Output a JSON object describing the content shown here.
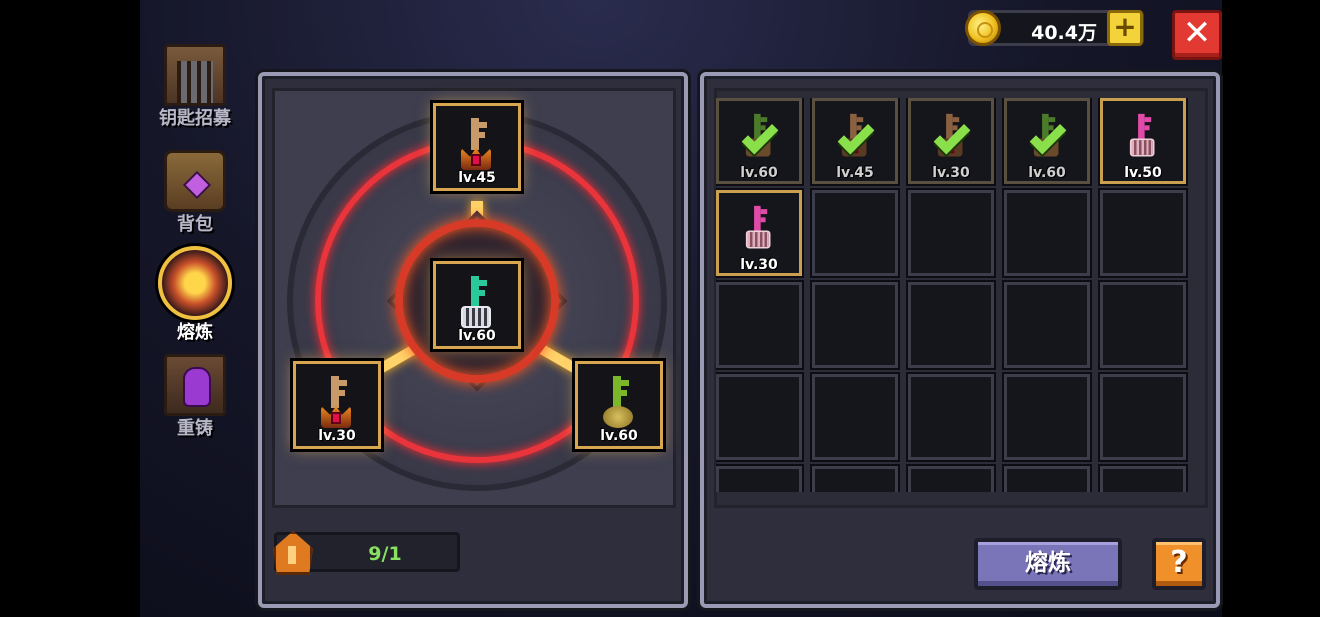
{
  "currency": {
    "amount": "40.4万",
    "add_icon": "plus-icon",
    "coin_icon": "gold-coin-icon"
  },
  "close": {
    "label": "✕",
    "icon": "close-icon"
  },
  "sidebar": {
    "items": [
      {
        "label": "钥匙招募",
        "icon": "gate-icon",
        "active": false
      },
      {
        "label": "背包",
        "icon": "backpack-icon",
        "active": false
      },
      {
        "label": "熔炼",
        "icon": "furnace-icon",
        "active": true
      },
      {
        "label": "重铸",
        "icon": "recast-icon",
        "active": false
      }
    ]
  },
  "forge": {
    "top_slot": {
      "level": "lv.45",
      "key": "bronze-key"
    },
    "left_slot": {
      "level": "lv.30",
      "key": "bronze-key"
    },
    "right_slot": {
      "level": "lv.60",
      "key": "green-key"
    },
    "result_slot": {
      "level": "lv.60",
      "key": "teal-key"
    },
    "count": "9/1"
  },
  "inventory": {
    "items": [
      {
        "level": "lv.60",
        "key": "darkgreen-key",
        "selected": true
      },
      {
        "level": "lv.45",
        "key": "brown-key",
        "selected": true
      },
      {
        "level": "lv.30",
        "key": "brown-key",
        "selected": true
      },
      {
        "level": "lv.60",
        "key": "darkgreen-key",
        "selected": true
      },
      {
        "level": "lv.50",
        "key": "pink-key",
        "selected": false
      },
      {
        "level": "lv.30",
        "key": "pink-key",
        "selected": false
      }
    ]
  },
  "actions": {
    "smelt_label": "熔炼",
    "help_label": "?"
  },
  "colors": {
    "ring": "#e8343a",
    "gold_border": "#d8a650",
    "button_purple": "#7a74b8",
    "button_orange": "#f0902a",
    "close_red": "#e23a32"
  }
}
